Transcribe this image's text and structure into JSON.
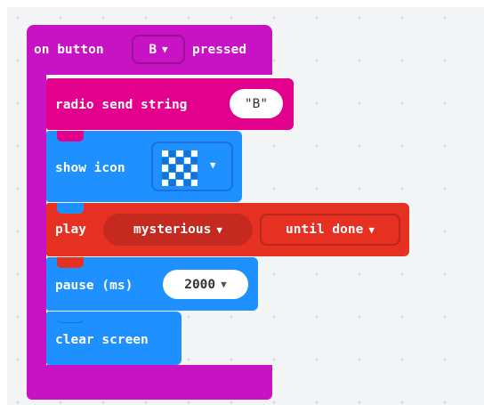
{
  "colors": {
    "event": "#c713c4",
    "radio": "#e3008c",
    "basic": "#1e90ff",
    "music": "#e63022",
    "music_dropdown": "#c42a1f"
  },
  "event_block": {
    "label_prefix": "on button",
    "button_value": "B",
    "label_suffix": "pressed"
  },
  "radio_block": {
    "label": "radio send string",
    "value": "\"B\""
  },
  "show_icon_block": {
    "label": "show icon",
    "icon": "checker-pattern-icon"
  },
  "play_block": {
    "label": "play",
    "melody": "mysterious",
    "mode": "until done"
  },
  "pause_block": {
    "label": "pause (ms)",
    "value": "2000"
  },
  "clear_block": {
    "label": "clear screen"
  }
}
